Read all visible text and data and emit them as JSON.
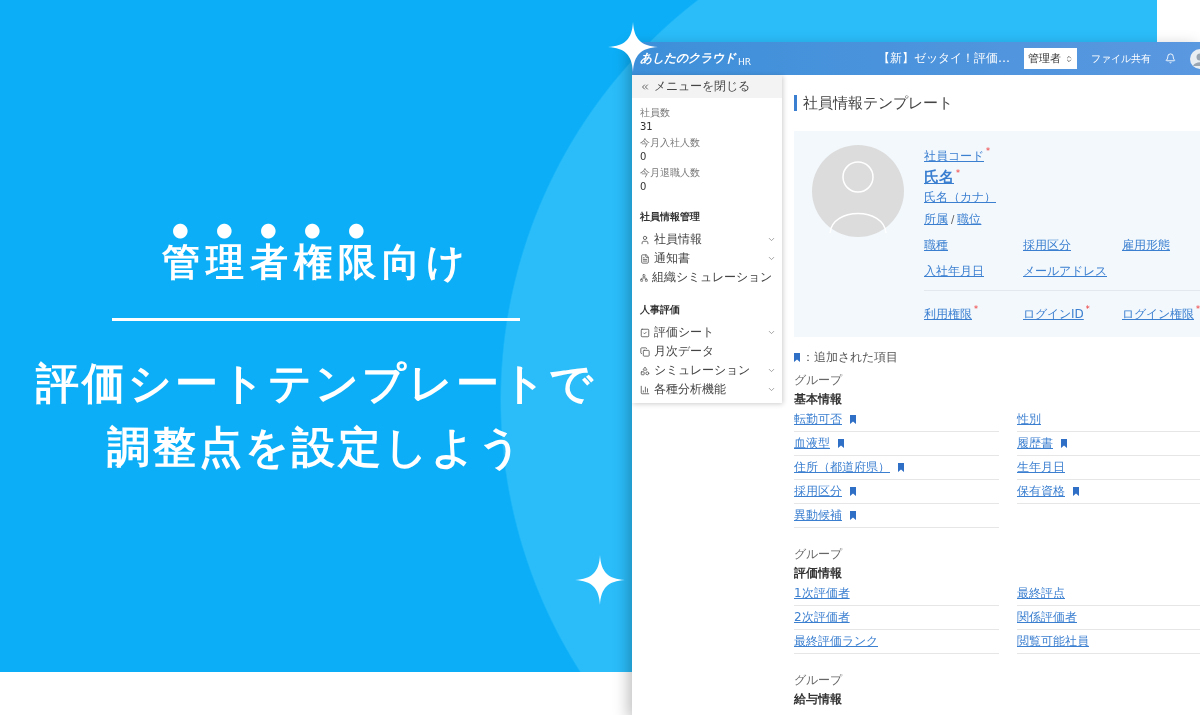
{
  "banner": {
    "heading": {
      "emphasized": "管理者権限",
      "plain": "向け"
    },
    "lines": [
      "評価シートテンプレートで",
      "調整点を設定しよう"
    ]
  },
  "app": {
    "header": {
      "logo": "あしたのクラウド",
      "logo_suffix": "HR",
      "notice": "【新】ゼッタイ！評価…",
      "role_select": "管理者",
      "file_share": "ファイル共有"
    },
    "sidebar": {
      "close_menu": "メニューを閉じる",
      "stats": [
        {
          "label": "社員数",
          "value": "31"
        },
        {
          "label": "今月入社人数",
          "value": "0"
        },
        {
          "label": "今月退職人数",
          "value": "0"
        }
      ],
      "sections": [
        {
          "title": "社員情報管理",
          "items": [
            {
              "label": "社員情報",
              "kind": "person",
              "has_submenu": true
            },
            {
              "label": "通知書",
              "kind": "document",
              "has_submenu": true
            },
            {
              "label": "組織シミュレーション",
              "kind": "org",
              "has_submenu": false
            }
          ]
        },
        {
          "title": "人事評価",
          "items": [
            {
              "label": "評価シート",
              "kind": "check",
              "has_submenu": true
            },
            {
              "label": "月次データ",
              "kind": "copy",
              "has_submenu": false
            },
            {
              "label": "シミュレーション",
              "kind": "simulation",
              "has_submenu": true
            },
            {
              "label": "各種分析機能",
              "kind": "chart",
              "has_submenu": true
            }
          ]
        }
      ]
    },
    "main": {
      "title": "社員情報テンプレート",
      "profile": {
        "code": {
          "label": "社員コード",
          "mark": "*"
        },
        "name": {
          "label": "氏名",
          "mark": "*"
        },
        "kana": "氏名（カナ）",
        "affiliation": "所属",
        "separator": "/",
        "position": "職位",
        "fields": [
          {
            "label": "職種"
          },
          {
            "label": "採用区分"
          },
          {
            "label": "雇用形態"
          },
          {
            "label": "入社年月日"
          },
          {
            "label": "メールアドレス"
          }
        ],
        "account_fields": [
          {
            "label": "利用権限",
            "mark": "*"
          },
          {
            "label": "ログインID",
            "mark": "*"
          },
          {
            "label": "ログイン権限",
            "mark": "*"
          }
        ]
      },
      "legend": "：追加された項目",
      "groups": [
        {
          "caption": "グループ",
          "name": "基本情報",
          "items": [
            {
              "label": "転勤可否",
              "added": true
            },
            {
              "label": "性別",
              "added": false
            },
            {
              "label": "血液型",
              "added": true
            },
            {
              "label": "履歴書",
              "added": true
            },
            {
              "label": "住所（都道府県）",
              "added": true
            },
            {
              "label": "生年月日",
              "added": false
            },
            {
              "label": "採用区分",
              "added": true
            },
            {
              "label": "保有資格",
              "added": true
            },
            {
              "label": "異動候補",
              "added": true
            }
          ]
        },
        {
          "caption": "グループ",
          "name": "評価情報",
          "items": [
            {
              "label": "1次評価者",
              "added": false
            },
            {
              "label": "最終評点",
              "added": false
            },
            {
              "label": "2次評価者",
              "added": false
            },
            {
              "label": "関係評価者",
              "added": false
            },
            {
              "label": "最終評価ランク",
              "added": false
            },
            {
              "label": "閲覧可能社員",
              "added": false
            }
          ]
        },
        {
          "caption": "グループ",
          "name": "給与情報"
        }
      ]
    }
  }
}
